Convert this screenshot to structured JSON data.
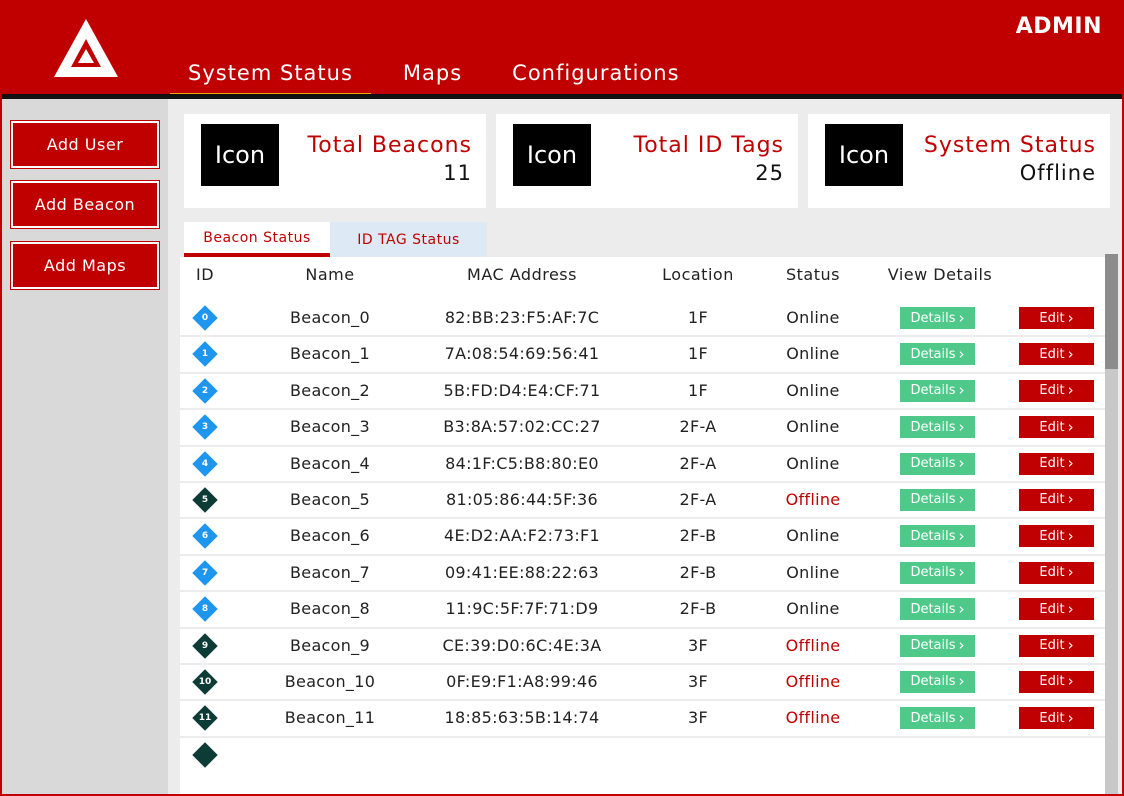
{
  "header": {
    "user_label": "ADMIN",
    "nav": [
      {
        "label": "System Status",
        "active": true
      },
      {
        "label": "Maps",
        "active": false
      },
      {
        "label": "Configurations",
        "active": false
      }
    ]
  },
  "sidebar": {
    "buttons": [
      "Add User",
      "Add Beacon",
      "Add Maps"
    ]
  },
  "cards": [
    {
      "icon": "Icon",
      "title": "Total Beacons",
      "value": "11"
    },
    {
      "icon": "Icon",
      "title": "Total ID Tags",
      "value": "25"
    },
    {
      "icon": "Icon",
      "title": "System Status",
      "value": "Offline"
    }
  ],
  "tabs": [
    {
      "label": "Beacon Status",
      "active": true
    },
    {
      "label": "ID TAG Status",
      "active": false
    }
  ],
  "table": {
    "columns": [
      "ID",
      "Name",
      "MAC Address",
      "Location",
      "Status",
      "View Details"
    ],
    "details_label": "Details",
    "edit_label": "Edit",
    "rows": [
      {
        "id": "0",
        "name": "Beacon_0",
        "mac": "82:BB:23:F5:AF:7C",
        "location": "1F",
        "status": "Online"
      },
      {
        "id": "1",
        "name": "Beacon_1",
        "mac": "7A:08:54:69:56:41",
        "location": "1F",
        "status": "Online"
      },
      {
        "id": "2",
        "name": "Beacon_2",
        "mac": "5B:FD:D4:E4:CF:71",
        "location": "1F",
        "status": "Online"
      },
      {
        "id": "3",
        "name": "Beacon_3",
        "mac": "B3:8A:57:02:CC:27",
        "location": "2F-A",
        "status": "Online"
      },
      {
        "id": "4",
        "name": "Beacon_4",
        "mac": "84:1F:C5:B8:80:E0",
        "location": "2F-A",
        "status": "Online"
      },
      {
        "id": "5",
        "name": "Beacon_5",
        "mac": "81:05:86:44:5F:36",
        "location": "2F-A",
        "status": "Offline"
      },
      {
        "id": "6",
        "name": "Beacon_6",
        "mac": "4E:D2:AA:F2:73:F1",
        "location": "2F-B",
        "status": "Online"
      },
      {
        "id": "7",
        "name": "Beacon_7",
        "mac": "09:41:EE:88:22:63",
        "location": "2F-B",
        "status": "Online"
      },
      {
        "id": "8",
        "name": "Beacon_8",
        "mac": "11:9C:5F:7F:71:D9",
        "location": "2F-B",
        "status": "Online"
      },
      {
        "id": "9",
        "name": "Beacon_9",
        "mac": "CE:39:D0:6C:4E:3A",
        "location": "3F",
        "status": "Offline"
      },
      {
        "id": "10",
        "name": "Beacon_10",
        "mac": "0F:E9:F1:A8:99:46",
        "location": "3F",
        "status": "Offline"
      },
      {
        "id": "11",
        "name": "Beacon_11",
        "mac": "18:85:63:5B:14:74",
        "location": "3F",
        "status": "Offline"
      }
    ]
  },
  "colors": {
    "brand_red": "#c00000",
    "online_marker": "#1e96f0",
    "offline_marker": "#0d3b36",
    "details_green": "#4fc98a",
    "active_tab_underline": "#f0a800"
  }
}
